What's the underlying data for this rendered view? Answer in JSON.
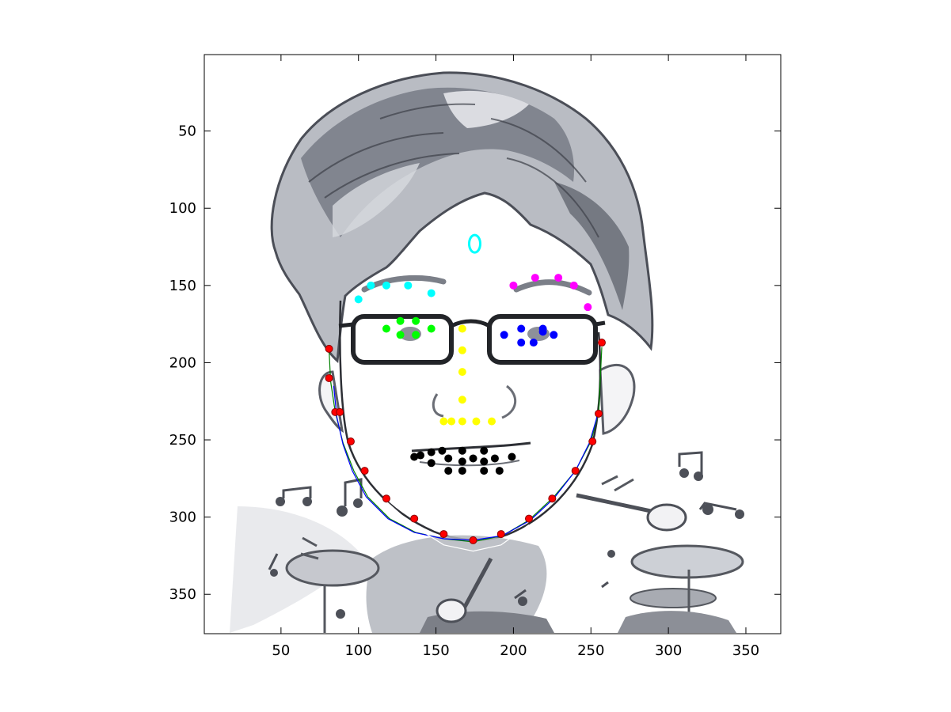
{
  "chart_data": {
    "type": "scatter",
    "title": "",
    "xlabel": "",
    "ylabel": "",
    "xlim": [
      0.5,
      372.5
    ],
    "ylim": [
      0.5,
      375.5
    ],
    "y_reversed": true,
    "grid": false,
    "x_ticks": [
      50,
      100,
      150,
      200,
      250,
      300,
      350
    ],
    "y_ticks": [
      50,
      100,
      150,
      200,
      250,
      300,
      350
    ],
    "background_image": "cartoon portrait sketch of a boy with glasses playing drums, with music notes",
    "series": [
      {
        "color": "#ff0000",
        "marker": "dot",
        "x": [
          81,
          81,
          85,
          88,
          95,
          104,
          118,
          136,
          155,
          174,
          192,
          210,
          225,
          240,
          251,
          255,
          257
        ],
        "y": [
          191,
          210,
          232,
          232,
          251,
          270,
          288,
          301,
          311,
          315,
          311,
          301,
          288,
          270,
          251,
          233,
          187
        ]
      },
      {
        "color": "#00ffff",
        "marker": "dot",
        "x": [
          100,
          108,
          118,
          132,
          147
        ],
        "y": [
          159,
          150,
          150,
          150,
          155
        ]
      },
      {
        "color": "#ff00ff",
        "marker": "dot",
        "x": [
          200,
          214,
          229,
          239,
          248
        ],
        "y": [
          150,
          145,
          145,
          150,
          164
        ]
      },
      {
        "color": "#00ff00",
        "marker": "dot",
        "x": [
          118,
          127,
          127,
          137,
          137,
          147
        ],
        "y": [
          178,
          173,
          182,
          173,
          182,
          178
        ]
      },
      {
        "color": "#0000ff",
        "marker": "dot",
        "x": [
          194,
          205,
          205,
          213,
          219,
          219,
          226
        ],
        "y": [
          182,
          178,
          187,
          187,
          178,
          180,
          182
        ]
      },
      {
        "color": "#ffff00",
        "marker": "dot",
        "x": [
          167,
          167,
          167,
          167,
          155,
          160,
          167,
          176,
          186
        ],
        "y": [
          178,
          192,
          206,
          224,
          238,
          238,
          238,
          238,
          238
        ]
      },
      {
        "color": "#000000",
        "marker": "dot",
        "x": [
          136,
          140,
          147,
          147,
          154,
          158,
          158,
          167,
          167,
          167,
          174,
          181,
          181,
          181,
          188,
          191,
          199
        ],
        "y": [
          261,
          260,
          265,
          258,
          257,
          270,
          262,
          257,
          264,
          270,
          262,
          257,
          264,
          270,
          262,
          270,
          261
        ]
      },
      {
        "color": "#00ffff",
        "marker": "ellipse",
        "x": [
          175
        ],
        "y": [
          123
        ]
      }
    ],
    "curves": [
      {
        "color": "#008000",
        "x": [
          81,
          82,
          85,
          90,
          97,
          106,
          120,
          137,
          155,
          174,
          193,
          210,
          226,
          240,
          250,
          255,
          257
        ],
        "y": [
          191,
          212,
          232,
          252,
          270,
          287,
          301,
          310,
          314,
          316,
          312,
          302,
          287,
          270,
          251,
          232,
          190
        ]
      },
      {
        "color": "#0000ff",
        "x": [
          84,
          86,
          90,
          96,
          105,
          119,
          136,
          155,
          174,
          193,
          211,
          226,
          240,
          249,
          254
        ],
        "y": [
          215,
          235,
          253,
          270,
          287,
          301,
          310,
          314,
          315,
          312,
          302,
          288,
          270,
          252,
          235
        ]
      },
      {
        "color": "#ffffff",
        "x": [
          118,
          136,
          155,
          174,
          192,
          210
        ],
        "y": [
          290,
          306,
          318,
          322,
          318,
          305
        ]
      }
    ]
  }
}
